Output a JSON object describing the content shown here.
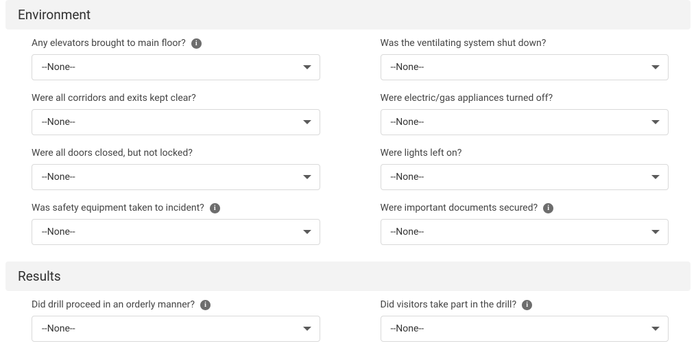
{
  "sections": {
    "environment": {
      "title": "Environment",
      "fields": {
        "elevators": {
          "label": "Any elevators brought to main floor?",
          "value": "--None--",
          "has_info": true
        },
        "ventilating": {
          "label": "Was the ventilating system shut down?",
          "value": "--None--",
          "has_info": false
        },
        "corridors": {
          "label": "Were all corridors and exits kept clear?",
          "value": "--None--",
          "has_info": false
        },
        "appliances": {
          "label": "Were electric/gas appliances turned off?",
          "value": "--None--",
          "has_info": false
        },
        "doors": {
          "label": "Were all doors closed, but not locked?",
          "value": "--None--",
          "has_info": false
        },
        "lights": {
          "label": "Were lights left on?",
          "value": "--None--",
          "has_info": false
        },
        "safety_equipment": {
          "label": "Was safety equipment taken to incident?",
          "value": "--None--",
          "has_info": true
        },
        "documents": {
          "label": "Were important documents secured?",
          "value": "--None--",
          "has_info": true
        }
      }
    },
    "results": {
      "title": "Results",
      "fields": {
        "orderly": {
          "label": "Did drill proceed in an orderly manner?",
          "value": "--None--",
          "has_info": true
        },
        "visitors": {
          "label": "Did visitors take part in the drill?",
          "value": "--None--",
          "has_info": true
        }
      }
    }
  },
  "info_glyph": "i"
}
